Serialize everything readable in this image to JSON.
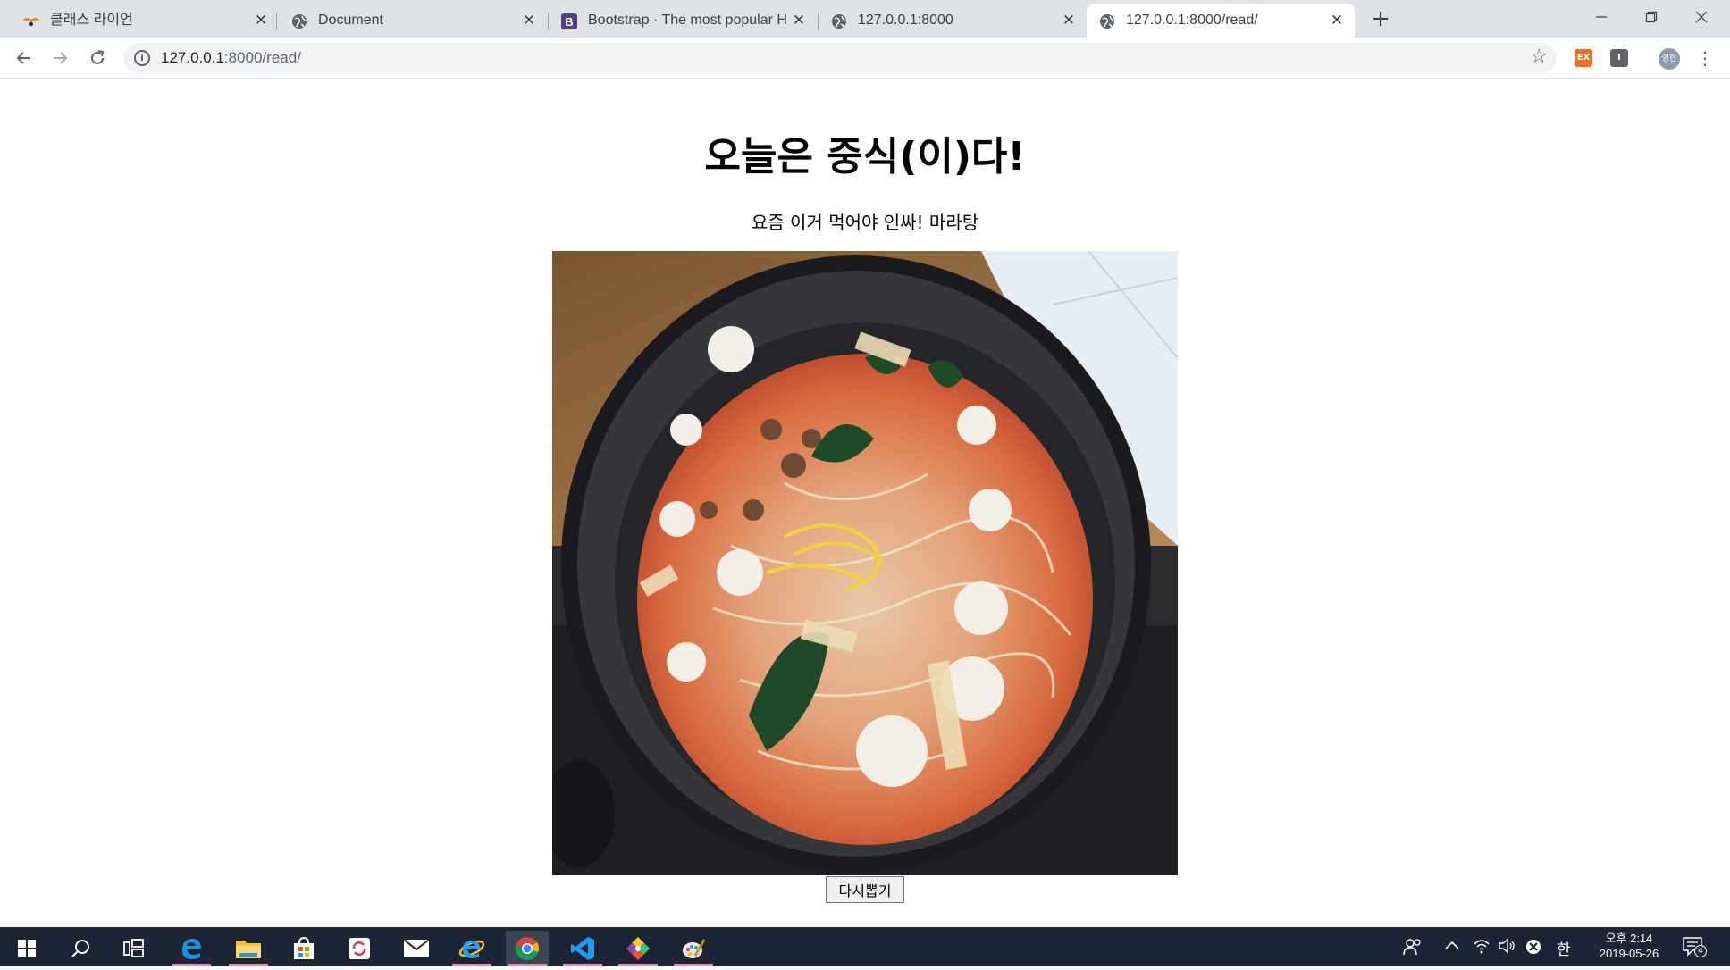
{
  "browser": {
    "tabs": [
      {
        "title": "클래스 라이언",
        "icon": "class-lion-icon"
      },
      {
        "title": "Document",
        "icon": "globe-icon"
      },
      {
        "title": "Bootstrap · The most popular H",
        "icon": "bootstrap-icon"
      },
      {
        "title": "127.0.0.1:8000",
        "icon": "globe-icon"
      },
      {
        "title": "127.0.0.1:8000/read/",
        "icon": "globe-icon",
        "active": true
      }
    ],
    "new_tab_label": "+",
    "url_host": "127.0.0.1",
    "url_path": ":8000/read/",
    "extensions": [
      {
        "label": "EX",
        "color": "#f26c22"
      },
      {
        "label": "I",
        "color": "#5f6368"
      }
    ],
    "profile_label": "영현"
  },
  "page": {
    "heading": "오늘은 중식(이)다!",
    "subtitle": "요즘 이거 먹어야 인싸! 마라탕",
    "image_alt": "마라탕",
    "reroll_button": "다시뽑기"
  },
  "taskbar": {
    "apps": [
      "start-icon",
      "search-icon",
      "task-view-icon",
      "edge-icon",
      "file-explorer-icon",
      "store-icon",
      "sync-app-icon",
      "mail-icon",
      "ie-icon",
      "chrome-icon",
      "vscode-icon",
      "git-kraken-icon",
      "paint-icon"
    ],
    "ime": "한",
    "time": "오후 2:14",
    "date": "2019-05-26",
    "notification_count": "4"
  }
}
